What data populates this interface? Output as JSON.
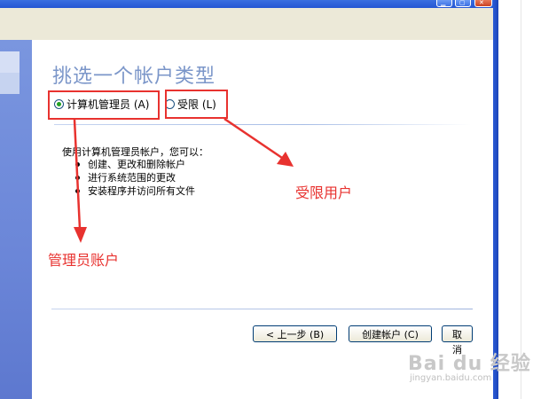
{
  "wizard": {
    "title": "挑选一个帐户类型",
    "options": [
      {
        "label": "计算机管理员 (A)",
        "checked": true
      },
      {
        "label": "受限 (L)",
        "checked": false
      }
    ],
    "description": "使用计算机管理员帐户，您可以：",
    "bullets": [
      "创建、更改和删除帐户",
      "进行系统范围的更改",
      "安装程序并访问所有文件"
    ],
    "buttons": {
      "back": "< 上一步 (B)",
      "create": "创建帐户 (C)",
      "cancel": "取消"
    }
  },
  "annotations": {
    "limited_label": "受限用户",
    "admin_label": "管理员账户",
    "color": "#e8322f"
  },
  "watermark": {
    "brand": "Bai du 经验",
    "url": "jingyan.baidu.com"
  },
  "colors": {
    "title_text": "#7b96c9",
    "left_panel": "#6b86d8",
    "titlebar": "#2556d3"
  }
}
